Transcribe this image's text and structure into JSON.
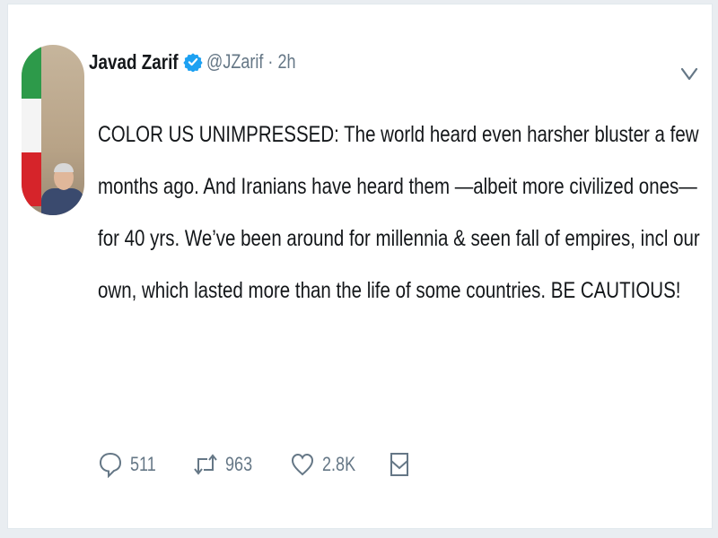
{
  "tweet": {
    "author_name": "Javad Zarif",
    "handle_time": "@JZarif · 2h",
    "text": "COLOR US UNIMPRESSED: The world heard even harsher bluster a few months ago. And Iranians have heard them —albeit more civilized ones—for 40 yrs. We’ve been around for millennia & seen fall of empires, incl our own, which lasted more than the life of some countries. BE CAUTIOUS!",
    "replies": "511",
    "retweets": "963",
    "likes": "2.8K"
  },
  "icons": {
    "verified": "verified-badge-icon",
    "caret": "chevron-down-icon",
    "reply": "reply-icon",
    "retweet": "retweet-icon",
    "like": "heart-icon",
    "dm": "direct-message-icon"
  },
  "colors": {
    "text": "#14171a",
    "muted": "#657786",
    "verified": "#1da1f2",
    "background": "#ffffff"
  }
}
